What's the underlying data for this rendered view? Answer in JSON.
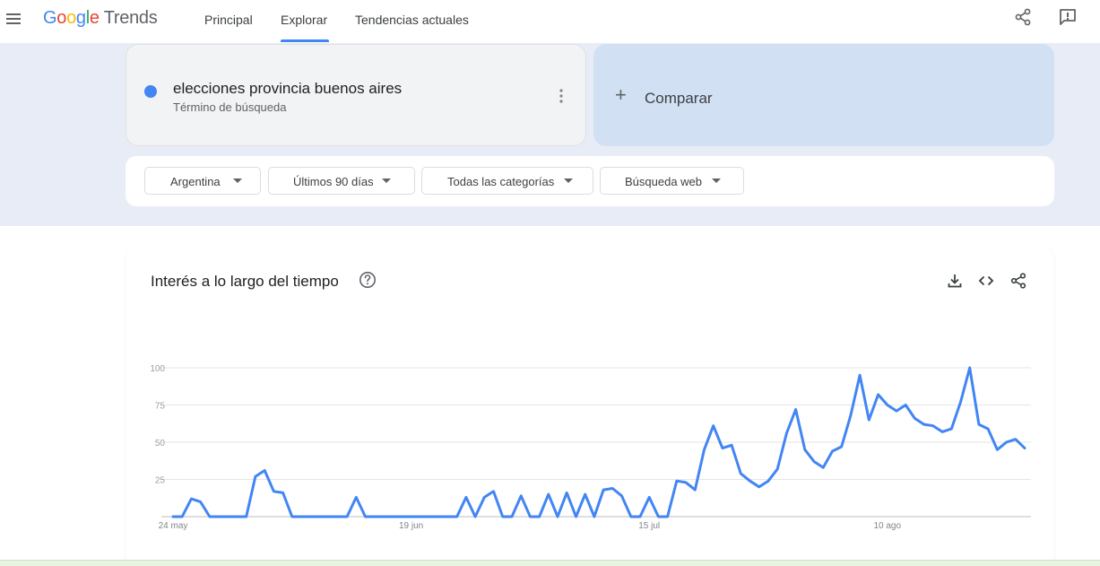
{
  "header": {
    "logo_google": "Google",
    "logo_trends": "Trends",
    "tabs": [
      {
        "label": "Principal"
      },
      {
        "label": "Explorar"
      },
      {
        "label": "Tendencias actuales"
      }
    ],
    "active_tab": "Explorar",
    "accent": "#4285f4"
  },
  "search": {
    "term": "elecciones provincia buenos aires",
    "term_type": "Término de búsqueda",
    "term_color": "#4285f4",
    "compare_label": "Comparar"
  },
  "filters": {
    "region": "Argentina",
    "period": "Últimos 90 días",
    "category": "Todas las categorías",
    "search_type": "Búsqueda web"
  },
  "chart": {
    "title": "Interés a lo largo del tiempo"
  },
  "chart_data": {
    "type": "line",
    "title": "Interés a lo largo del tiempo",
    "xlabel": "",
    "ylabel": "",
    "ylim": [
      0,
      100
    ],
    "yticks": [
      "100",
      "75",
      "50",
      "25"
    ],
    "xtick_labels": [
      "24 may",
      "19 jun",
      "15 jul",
      "10 ago"
    ],
    "xtick_index": [
      0,
      26,
      52,
      78
    ],
    "grid": true,
    "series": [
      {
        "color": "#4285f4",
        "values": [
          0,
          0,
          12,
          10,
          0,
          0,
          0,
          0,
          0,
          27,
          31,
          17,
          16,
          0,
          0,
          0,
          0,
          0,
          0,
          0,
          13,
          0,
          0,
          0,
          0,
          0,
          0,
          0,
          0,
          0,
          0,
          0,
          13,
          0,
          13,
          17,
          0,
          0,
          14,
          0,
          0,
          15,
          0,
          16,
          0,
          15,
          0,
          18,
          19,
          14,
          0,
          0,
          13,
          0,
          0,
          24,
          23,
          18,
          45,
          61,
          46,
          48,
          29,
          24,
          20,
          24,
          32,
          56,
          72,
          45,
          37,
          33,
          44,
          47,
          68,
          95,
          65,
          82,
          75,
          71,
          75,
          66,
          62,
          61,
          57,
          59,
          77,
          100,
          62,
          59,
          45,
          50,
          52,
          46
        ]
      }
    ]
  }
}
